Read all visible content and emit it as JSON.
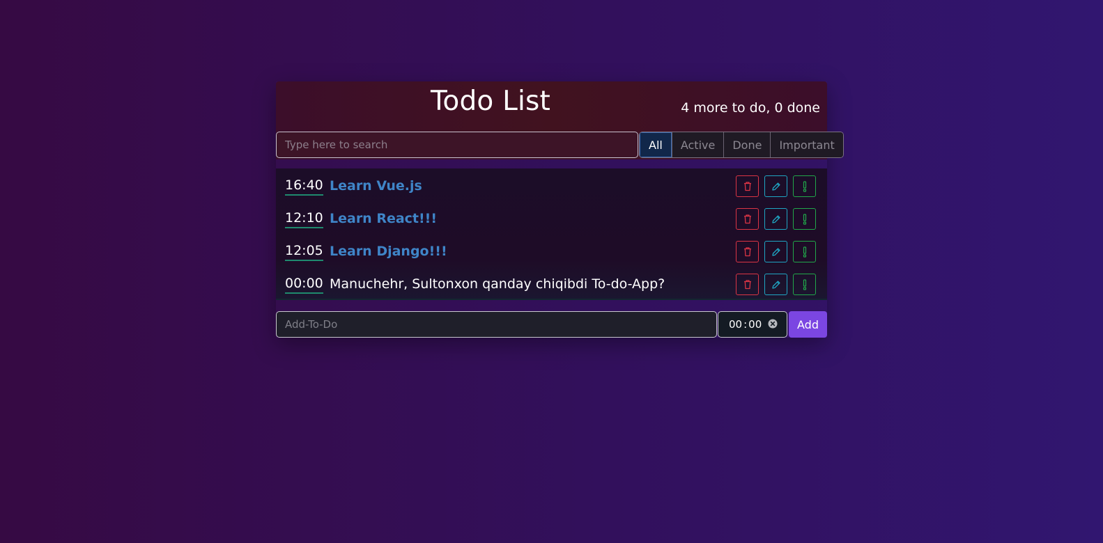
{
  "header": {
    "title": "Todo List",
    "counter": "4 more to do, 0 done"
  },
  "search": {
    "placeholder": "Type here to search",
    "value": ""
  },
  "filters": [
    {
      "label": "All",
      "active": true
    },
    {
      "label": "Active",
      "active": false
    },
    {
      "label": "Done",
      "active": false
    },
    {
      "label": "Important",
      "active": false
    }
  ],
  "todos": [
    {
      "time": "16:40",
      "label": "Learn Vue.js",
      "important": true
    },
    {
      "time": "12:10",
      "label": "Learn React!!!",
      "important": true
    },
    {
      "time": "12:05",
      "label": "Learn Django!!!",
      "important": true
    },
    {
      "time": "00:00",
      "label": "Manuchehr, Sultonxon qanday chiqibdi To-do-App?",
      "important": false
    }
  ],
  "item_actions": {
    "delete_icon": "trash-icon",
    "edit_icon": "pencil-icon",
    "important_icon": "exclamation-icon"
  },
  "add_form": {
    "placeholder": "Add-To-Do",
    "value": "",
    "time_hours": "00",
    "time_separator": ":",
    "time_minutes": "00",
    "clear_icon": "clear-circle-icon",
    "add_label": "Add"
  },
  "colors": {
    "delete": "#dc3545",
    "edit": "#1fa7c4",
    "important": "#21a84a",
    "important_text": "#3f85c8",
    "add_button": "#7b46e2",
    "active_filter": "#11274a"
  }
}
